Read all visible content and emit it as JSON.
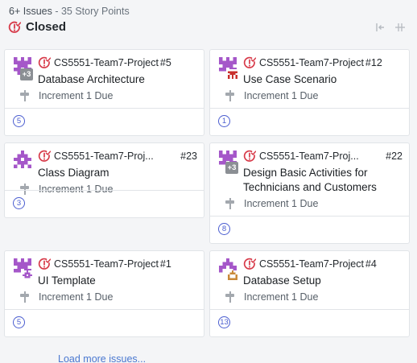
{
  "header": {
    "issue_count": "6+ Issues",
    "separator": " - ",
    "story_points": "35 Story Points",
    "title": "Closed",
    "state_color": "#d73a49"
  },
  "cards": [
    {
      "repo": "CS5551-Team7-Project",
      "number": "#5",
      "title": "Database Architecture",
      "milestone": "Increment 1 Due",
      "points": "5",
      "extra_assignees": "+3"
    },
    {
      "repo": "CS5551-Team7-Project",
      "number": "#12",
      "title": "Use Case Scenario",
      "milestone": "Increment 1 Due",
      "points": "1"
    },
    {
      "repo": "CS5551-Team7-Proj...",
      "number": "#23",
      "title": "Class Diagram",
      "milestone": "Increment 1 Due",
      "points": "3"
    },
    {
      "repo": "CS5551-Team7-Proj...",
      "number": "#22",
      "title": "Design Basic Activities for Technicians and Customers",
      "milestone": "Increment 1 Due",
      "points": "8",
      "extra_assignees": "+3"
    },
    {
      "repo": "CS5551-Team7-Project",
      "number": "#1",
      "title": "UI Template",
      "milestone": "Increment 1 Due",
      "points": "5"
    },
    {
      "repo": "CS5551-Team7-Project",
      "number": "#4",
      "title": "Database Setup",
      "milestone": "Increment 1 Due",
      "points": "13"
    }
  ],
  "footer": {
    "load_more": "Load more issues..."
  },
  "icons": {
    "state": "closed-issue-icon",
    "milestone": "milestone-icon",
    "collapse": "collapse-icon",
    "expand": "expand-icon"
  },
  "colors": {
    "closed_red": "#d73a49",
    "points_blue": "#4a5dd0",
    "avatar_purple": "#a557c9",
    "link_blue": "#4a78d0"
  }
}
